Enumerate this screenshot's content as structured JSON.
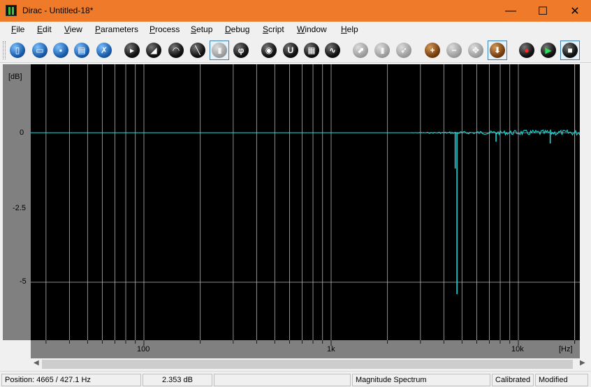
{
  "window": {
    "title": "Dirac - Untitled-18*",
    "controls": {
      "minimize": "—",
      "maximize": "☐",
      "close": "✕"
    }
  },
  "menu": [
    {
      "label": "File",
      "key": "F",
      "rest": "ile"
    },
    {
      "label": "Edit",
      "key": "E",
      "rest": "dit"
    },
    {
      "label": "View",
      "key": "V",
      "rest": "iew"
    },
    {
      "label": "Parameters",
      "key": "P",
      "rest": "arameters"
    },
    {
      "label": "Process",
      "key": "P",
      "rest": "rocess"
    },
    {
      "label": "Setup",
      "key": "S",
      "rest": "etup"
    },
    {
      "label": "Debug",
      "key": "D",
      "rest": "ebug"
    },
    {
      "label": "Script",
      "key": "S",
      "rest": "cript"
    },
    {
      "label": "Window",
      "key": "W",
      "rest": "indow"
    },
    {
      "label": "Help",
      "key": "H",
      "rest": "elp"
    }
  ],
  "toolbar": [
    {
      "name": "new-icon",
      "style": "b",
      "glyph": "▯",
      "active": false
    },
    {
      "name": "open-icon",
      "style": "b",
      "glyph": "▭",
      "active": false
    },
    {
      "name": "save-icon",
      "style": "b",
      "glyph": "▪",
      "active": false
    },
    {
      "name": "print-icon",
      "style": "b",
      "glyph": "▤",
      "active": false
    },
    {
      "name": "delete-icon",
      "style": "b",
      "glyph": "✗",
      "active": false
    },
    {
      "name": "view-impulse-icon",
      "style": "k",
      "glyph": "▸",
      "active": false
    },
    {
      "name": "view-energy-icon",
      "style": "k",
      "glyph": "◢",
      "active": false
    },
    {
      "name": "view-schroeder-icon",
      "style": "k",
      "glyph": "◠",
      "active": false
    },
    {
      "name": "view-decay-icon",
      "style": "k",
      "glyph": "╲",
      "active": false
    },
    {
      "name": "view-magnitude-icon",
      "style": "g",
      "glyph": "|||",
      "active": true
    },
    {
      "name": "view-phase-icon",
      "style": "k",
      "glyph": "φ",
      "active": false
    },
    {
      "name": "view-spectrogram-icon",
      "style": "k",
      "glyph": "◉",
      "active": false
    },
    {
      "name": "view-polar-icon",
      "style": "k",
      "glyph": "U",
      "active": false
    },
    {
      "name": "view-table-icon",
      "style": "k",
      "glyph": "▦",
      "active": false
    },
    {
      "name": "view-waveform-icon",
      "style": "k",
      "glyph": "∿",
      "active": false
    },
    {
      "name": "zoom-icon",
      "style": "g",
      "glyph": "⬈",
      "active": false
    },
    {
      "name": "columns-icon",
      "style": "g",
      "glyph": "|||",
      "active": false
    },
    {
      "name": "pointer-icon",
      "style": "g",
      "glyph": "➶",
      "active": false
    },
    {
      "name": "add-icon",
      "style": "br",
      "glyph": "+",
      "active": false
    },
    {
      "name": "remove-icon",
      "style": "g",
      "glyph": "−",
      "active": false
    },
    {
      "name": "move-icon",
      "style": "g",
      "glyph": "✥",
      "active": false
    },
    {
      "name": "down-icon",
      "style": "br",
      "glyph": "⬇",
      "active": true
    },
    {
      "name": "record-icon",
      "style": "k",
      "glyph": "●",
      "active": false,
      "color": "#ff2a2a"
    },
    {
      "name": "play-icon",
      "style": "k",
      "glyph": "▶",
      "active": false,
      "color": "#2adf5a"
    },
    {
      "name": "stop-icon",
      "style": "k",
      "glyph": "■",
      "active": true,
      "color": "#ffffff"
    }
  ],
  "plot": {
    "y_unit": "[dB]",
    "y_ticks": [
      "0",
      "-2.5",
      "-5"
    ],
    "x_unit": "[Hz]",
    "x_ticks": [
      "100",
      "1k",
      "10k"
    ],
    "background": "#000000",
    "grid_color": "#b4b4b4",
    "trace_color": "#19e6e6"
  },
  "status": {
    "position": "Position: 4665 / 427.1 Hz",
    "level": "2.353 dB",
    "blank1": "",
    "view": "Magnitude Spectrum",
    "calibrated": "Calibrated",
    "modified": "Modified"
  }
}
